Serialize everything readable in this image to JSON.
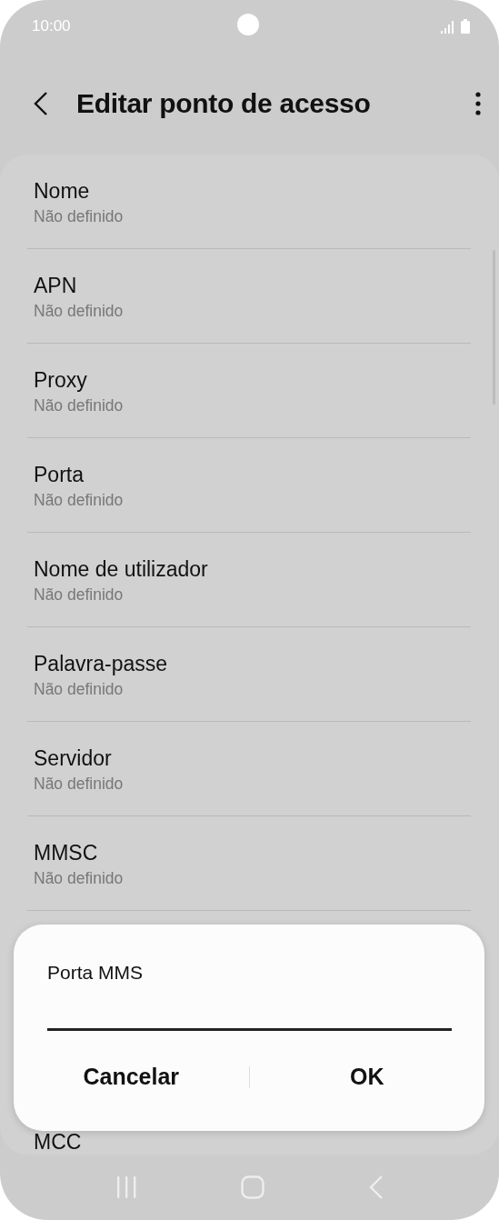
{
  "status_bar": {
    "time": "10:00"
  },
  "header": {
    "title": "Editar ponto de acesso"
  },
  "settings": [
    {
      "kind": "entry",
      "title": "Nome",
      "value": "Não definido"
    },
    {
      "kind": "entry",
      "title": "APN",
      "value": "Não definido"
    },
    {
      "kind": "entry",
      "title": "Proxy",
      "value": "Não definido"
    },
    {
      "kind": "entry",
      "title": "Porta",
      "value": "Não definido"
    },
    {
      "kind": "entry",
      "title": "Nome de utilizador",
      "value": "Não definido"
    },
    {
      "kind": "entry",
      "title": "Palavra-passe",
      "value": "Não definido"
    },
    {
      "kind": "entry",
      "title": "Servidor",
      "value": "Não definido"
    },
    {
      "kind": "entry",
      "title": "MMSC",
      "value": "Não definido"
    },
    {
      "kind": "partial",
      "title": "MCC"
    }
  ],
  "dialog": {
    "title": "Porta MMS",
    "buttons": [
      "Cancelar",
      "OK"
    ]
  }
}
